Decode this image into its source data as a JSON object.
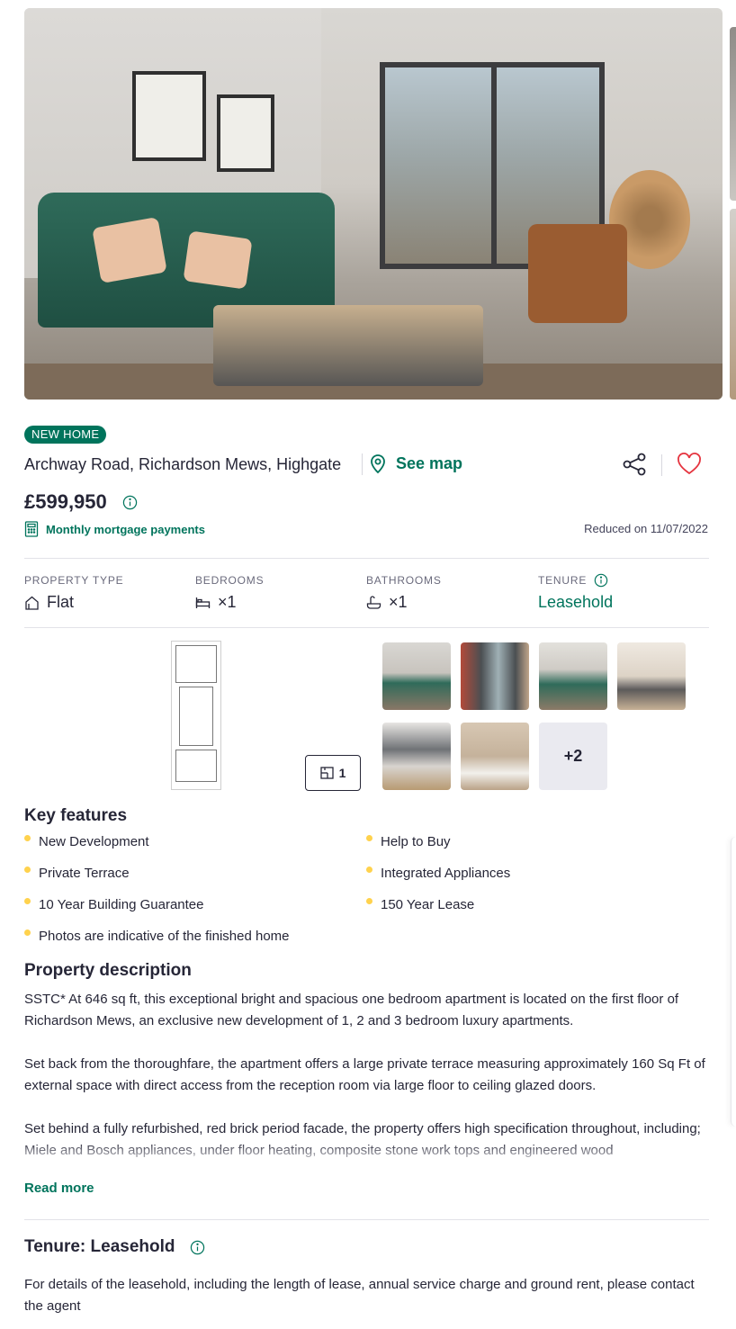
{
  "listing": {
    "badge": "NEW HOME",
    "address": "Archway Road, Richardson Mews, Highgate",
    "see_map": "See map",
    "price": "£599,950",
    "mortgage_link": "Monthly mortgage payments",
    "reduced": "Reduced on 11/07/2022"
  },
  "stats": {
    "property_type_label": "PROPERTY TYPE",
    "property_type_value": "Flat",
    "bedrooms_label": "BEDROOMS",
    "bedrooms_value": "×1",
    "bathrooms_label": "BATHROOMS",
    "bathrooms_value": "×1",
    "tenure_label": "TENURE",
    "tenure_value": "Leasehold"
  },
  "media": {
    "floorplan_count": "1",
    "more_photos": "+2"
  },
  "key_features": {
    "title": "Key features",
    "left": [
      "New Development",
      "Private Terrace",
      "10 Year Building Guarantee",
      "Photos are indicative of the finished home"
    ],
    "right": [
      "Help to Buy",
      "Integrated Appliances",
      "150 Year Lease"
    ]
  },
  "description": {
    "title": "Property description",
    "p1": "SSTC* At 646 sq ft, this exceptional bright and spacious one bedroom apartment is located on the first floor of Richardson Mews, an exclusive new development of 1, 2 and 3 bedroom luxury apartments.",
    "p2": "Set back from the thoroughfare, the apartment offers a large private terrace measuring approximately 160 Sq Ft of external space with direct access from the reception room via large floor to ceiling glazed doors.",
    "p3": "Set behind a fully refurbished, red brick period facade, the property offers high specification throughout, including; Miele and Bosch appliances, under floor heating, composite stone work tops and engineered wood",
    "read_more": "Read more"
  },
  "tenure_section": {
    "title": "Tenure: Leasehold",
    "text": "For details of the leasehold, including the length of lease, annual service charge and ground rent, please contact the agent"
  },
  "colors": {
    "brand_green": "#00745c",
    "text": "#262637",
    "bullet": "#ffd24d"
  }
}
